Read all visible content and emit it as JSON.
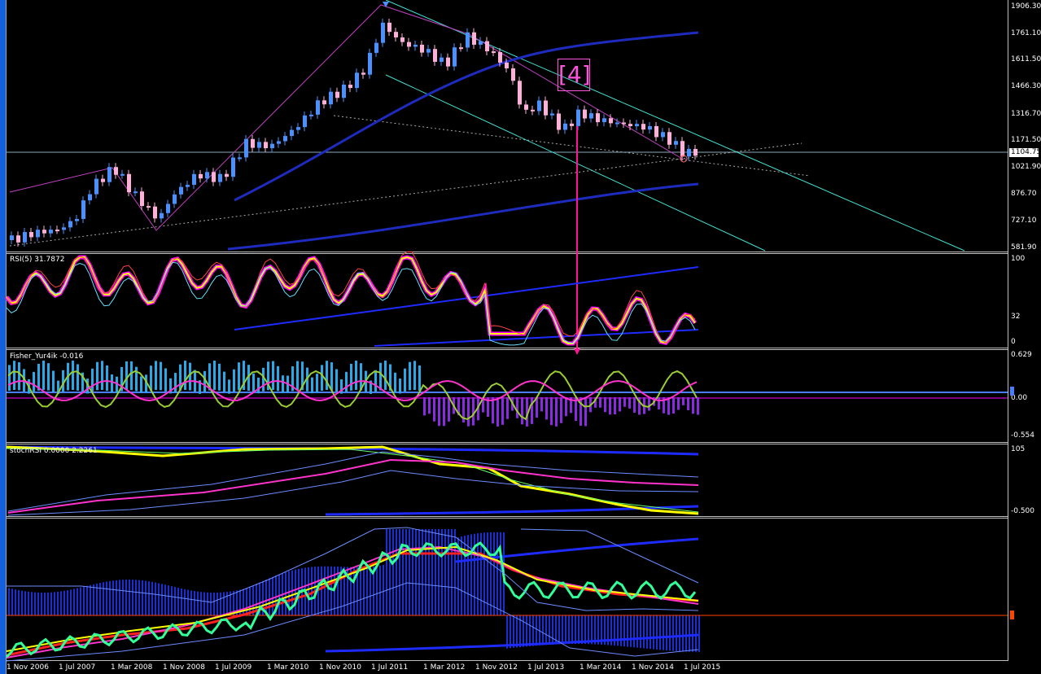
{
  "window": {
    "title": ""
  },
  "price_pane": {
    "axis_labels": [
      "1906.30",
      "1761.10",
      "1611.50",
      "1466.30",
      "1316.70",
      "1171.50",
      "1021.90",
      "876.70",
      "727.10",
      "581.90"
    ],
    "current_price": "1104.75",
    "wave_label": "[4]"
  },
  "rsi_pane": {
    "title": "RSI(5) 31.7872",
    "axis_labels": [
      "100",
      "32",
      "0"
    ]
  },
  "fisher_pane": {
    "title": "Fisher_Yur4ik -0.016",
    "axis_labels": [
      "0.629",
      "0.00",
      "-0.554"
    ]
  },
  "stoch_pane": {
    "title": "stochRSI 0.0000 2.2261",
    "axis_labels": [
      "105",
      "-0.500"
    ]
  },
  "time_axis": {
    "labels": [
      "1 Nov 2006",
      "1 Jul 2007",
      "1 Mar 2008",
      "1 Nov 2008",
      "1 Jul 2009",
      "1 Mar 2010",
      "1 Nov 2010",
      "1 Jul 2011",
      "1 Mar 2012",
      "1 Nov 2012",
      "1 Jul 2013",
      "1 Mar 2014",
      "1 Nov 2014",
      "1 Jul 2015"
    ]
  },
  "colors": {
    "background": "#000000",
    "bull_candle": "#4a90ff",
    "bear_candle": "#ffb0d8",
    "channel": "#40e0d0",
    "rsi_line": "#ffff00",
    "rsi_glow": "#ff00ff",
    "ma_blue": "#1e2bbf",
    "fisher_hist_pos": "#2aa8e8",
    "fisher_hist_neg": "#8a2be2",
    "fisher_line": "#9acd32",
    "marker_arrow": "#ff1493"
  }
}
